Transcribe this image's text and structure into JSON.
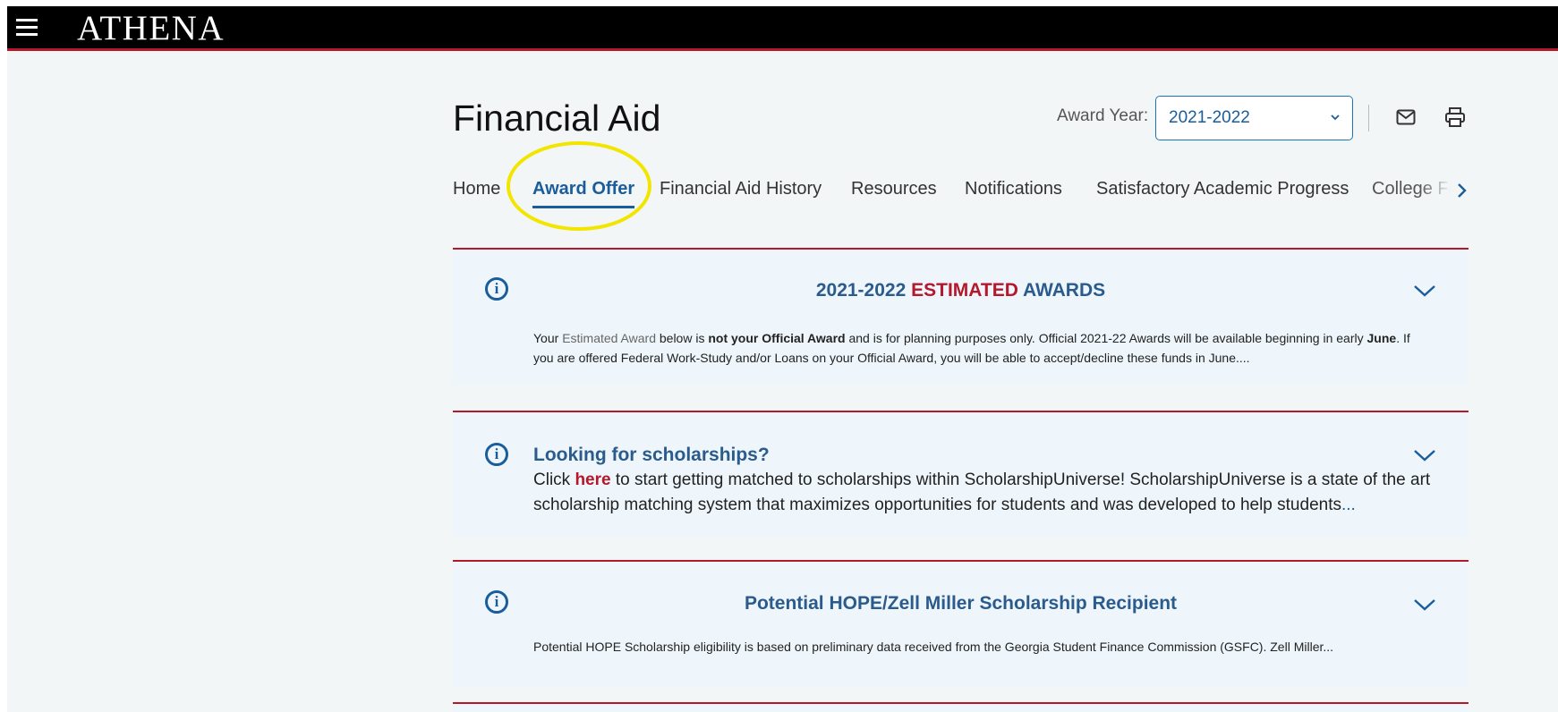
{
  "header": {
    "brand": "ATHENA"
  },
  "page": {
    "title": "Financial Aid",
    "award_year_label": "Award Year:",
    "award_year_value": "2021-2022"
  },
  "tabs": [
    {
      "label": "Home"
    },
    {
      "label": "Award Offer",
      "active": true
    },
    {
      "label": "Financial Aid History"
    },
    {
      "label": "Resources"
    },
    {
      "label": "Notifications"
    },
    {
      "label": "Satisfactory Academic Progress"
    },
    {
      "label": "College Fi"
    }
  ],
  "cards": {
    "estimated": {
      "title_year": "2021-2022",
      "title_emph": "ESTIMATED",
      "title_rest": "AWARDS",
      "body_1": "Your ",
      "body_muted": "Estimated Award",
      "body_2": " below is ",
      "body_bold_1": "not your Official Award",
      "body_3": " and is for planning purposes only. Official 2021-22 Awards will be available beginning in early ",
      "body_bold_2": "June",
      "body_4": ". If you are offered Federal Work-Study and/or Loans on your Official Award, you will be able to accept/decline these funds in June...."
    },
    "scholarships": {
      "title": "Looking for scholarships?",
      "body_1": "Click ",
      "link": "here",
      "body_2": " to start getting matched to scholarships within ScholarshipUniverse! ScholarshipUniverse is a state of the art scholarship matching system that maximizes opportunities for students and was developed to help students",
      "ellipsis": "..."
    },
    "hope": {
      "title": "Potential HOPE/Zell Miller Scholarship Recipient",
      "body": "Potential HOPE Scholarship eligibility is based on preliminary data received from the Georgia Student Finance Commission (GSFC). Zell Miller..."
    }
  },
  "colors": {
    "brand_red": "#b5172b",
    "link_blue": "#1a5d9b",
    "highlight_yellow": "#f2e600"
  }
}
